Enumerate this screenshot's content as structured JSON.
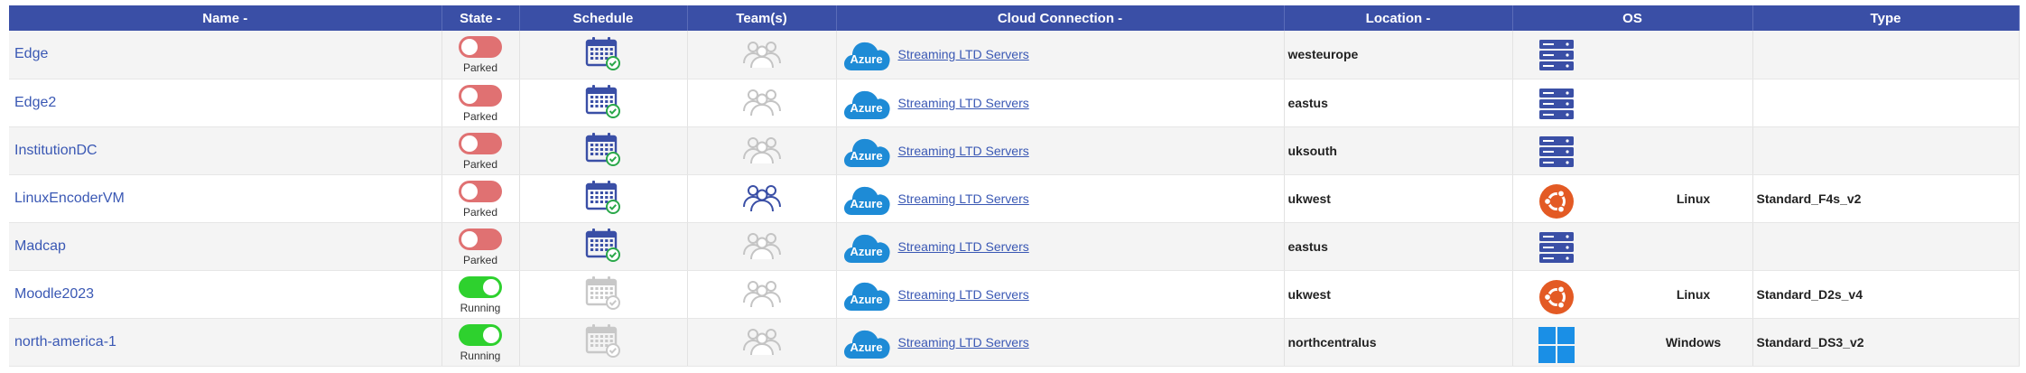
{
  "headers": {
    "name": "Name -",
    "state": "State -",
    "schedule": "Schedule",
    "teams": "Team(s)",
    "cloud": "Cloud Connection -",
    "location": "Location -",
    "os": "OS",
    "type": "Type"
  },
  "azure_label": "Azure",
  "colors": {
    "header_bg": "#3a4fa6",
    "link": "#3a58b4",
    "parked_toggle": "#e07172",
    "running_toggle": "#2ed12e",
    "azure_blue": "#1e8bd6",
    "server_icon": "#3a4fa6",
    "ubuntu_orange": "#e35a24",
    "windows_blue": "#1a8fe6"
  },
  "rows": [
    {
      "name": "Edge",
      "state": "Parked",
      "running": false,
      "schedule_active": true,
      "teams_active": false,
      "cloud": "Streaming LTD Servers",
      "location": "westeurope",
      "os_icon": "server-icon",
      "os": "",
      "type": ""
    },
    {
      "name": "Edge2",
      "state": "Parked",
      "running": false,
      "schedule_active": true,
      "teams_active": false,
      "cloud": "Streaming LTD Servers",
      "location": "eastus",
      "os_icon": "server-icon",
      "os": "",
      "type": ""
    },
    {
      "name": "InstitutionDC",
      "state": "Parked",
      "running": false,
      "schedule_active": true,
      "teams_active": false,
      "cloud": "Streaming LTD Servers",
      "location": "uksouth",
      "os_icon": "server-icon",
      "os": "",
      "type": ""
    },
    {
      "name": "LinuxEncoderVM",
      "state": "Parked",
      "running": false,
      "schedule_active": true,
      "teams_active": true,
      "cloud": "Streaming LTD Servers",
      "location": "ukwest",
      "os_icon": "ubuntu-icon",
      "os": "Linux",
      "type": "Standard_F4s_v2"
    },
    {
      "name": "Madcap",
      "state": "Parked",
      "running": false,
      "schedule_active": true,
      "teams_active": false,
      "cloud": "Streaming LTD Servers",
      "location": "eastus",
      "os_icon": "server-icon",
      "os": "",
      "type": ""
    },
    {
      "name": "Moodle2023",
      "state": "Running",
      "running": true,
      "schedule_active": false,
      "teams_active": false,
      "cloud": "Streaming LTD Servers",
      "location": "ukwest",
      "os_icon": "ubuntu-icon",
      "os": "Linux",
      "type": "Standard_D2s_v4"
    },
    {
      "name": "north-america-1",
      "state": "Running",
      "running": true,
      "schedule_active": false,
      "teams_active": false,
      "cloud": "Streaming LTD Servers",
      "location": "northcentralus",
      "os_icon": "windows-icon",
      "os": "Windows",
      "type": "Standard_DS3_v2"
    }
  ]
}
